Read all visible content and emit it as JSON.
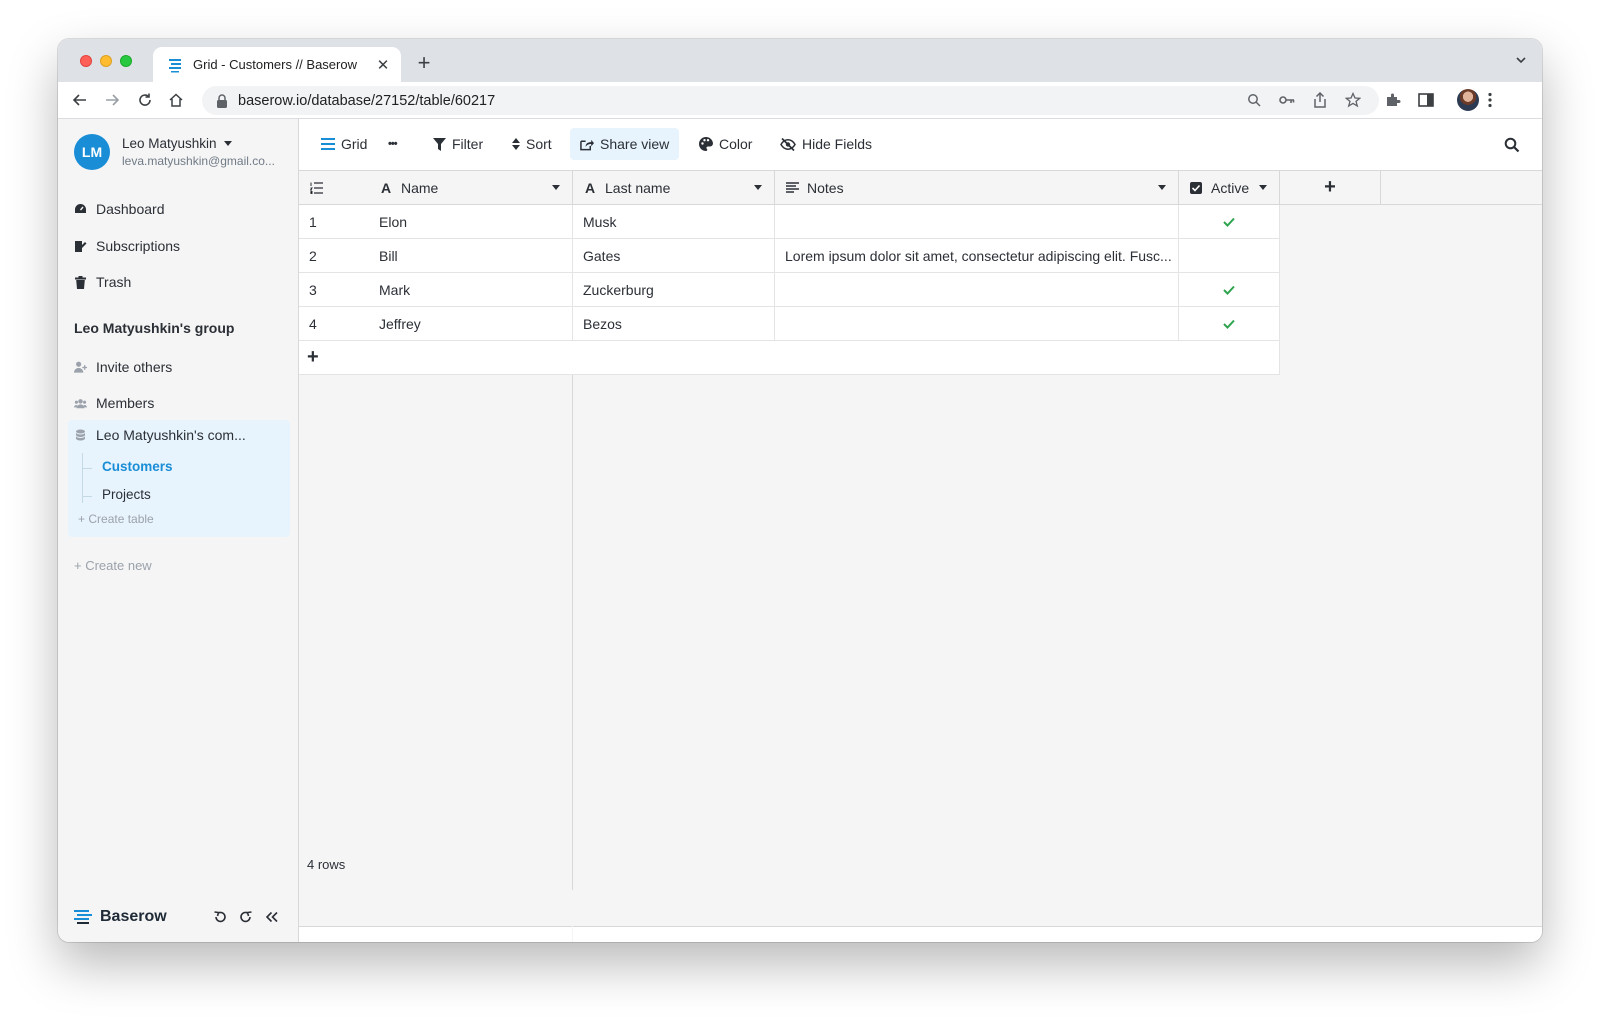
{
  "browser": {
    "tab_title": "Grid - Customers // Baserow",
    "url": "baserow.io/database/27152/table/60217"
  },
  "user": {
    "initials": "LM",
    "name": "Leo Matyushkin",
    "email": "leva.matyushkin@gmail.co..."
  },
  "sidebar": {
    "nav": [
      {
        "label": "Dashboard",
        "icon": "dashboard-icon"
      },
      {
        "label": "Subscriptions",
        "icon": "subscriptions-icon"
      },
      {
        "label": "Trash",
        "icon": "trash-icon"
      }
    ],
    "group_title": "Leo Matyushkin's group",
    "group_items": [
      {
        "label": "Invite others",
        "icon": "invite-icon"
      },
      {
        "label": "Members",
        "icon": "members-icon"
      }
    ],
    "database": "Leo Matyushkin's com...",
    "tables": [
      {
        "label": "Customers",
        "active": true
      },
      {
        "label": "Projects",
        "active": false
      }
    ],
    "create_table": "Create table",
    "create_new": "Create new",
    "brand": "Baserow"
  },
  "toolbar": {
    "view": "Grid",
    "more": "•••",
    "filter": "Filter",
    "sort": "Sort",
    "share_view": "Share view",
    "color": "Color",
    "hide_fields": "Hide Fields"
  },
  "grid": {
    "columns": {
      "name": "Name",
      "last_name": "Last name",
      "notes": "Notes",
      "active": "Active"
    },
    "rows": [
      {
        "id": "1",
        "name": "Elon",
        "last_name": "Musk",
        "notes": "",
        "active": true
      },
      {
        "id": "2",
        "name": "Bill",
        "last_name": "Gates",
        "notes": "Lorem ipsum dolor sit amet, consectetur adipiscing elit. Fusc...",
        "active": false
      },
      {
        "id": "3",
        "name": "Mark",
        "last_name": "Zuckerburg",
        "notes": "",
        "active": true
      },
      {
        "id": "4",
        "name": "Jeffrey",
        "last_name": "Bezos",
        "notes": "",
        "active": true
      }
    ],
    "row_count": "4 rows"
  },
  "colors": {
    "accent": "#198dd6",
    "check": "#2ea44f"
  }
}
